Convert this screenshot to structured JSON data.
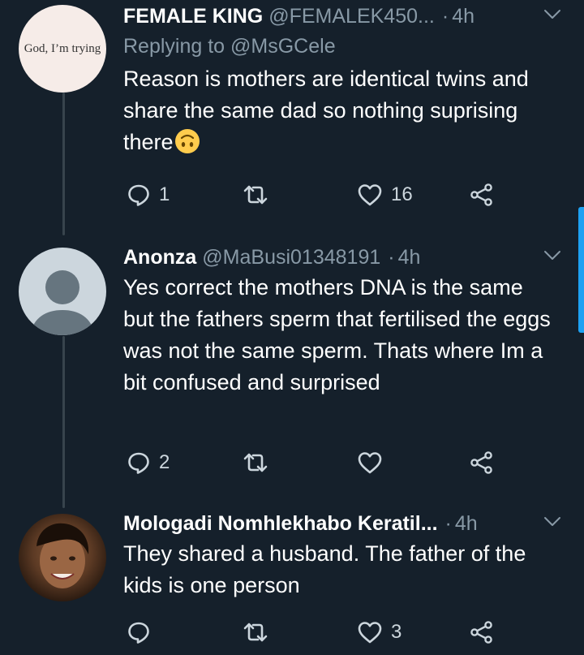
{
  "tweets": [
    {
      "avatar_text": "God, I’m trying",
      "name": "FEMALE KING",
      "handle": "@FEMALEK450...",
      "dot": "·",
      "time": "4h",
      "reply_prefix": "Replying to",
      "reply_handle": "@MsGCele",
      "text": "Reason is mothers are identical twins and share the same dad so nothing suprising there",
      "emoji": "upside-down-face",
      "replies": "1",
      "retweets": "",
      "likes": "16"
    },
    {
      "name": "Anonza",
      "handle": "@MaBusi01348191",
      "dot": "·",
      "time": "4h",
      "text": "Yes correct the mothers DNA is the same but the fathers sperm that fertilised the eggs was not the same sperm. Thats where Im a bit confused and surprised",
      "replies": "2",
      "retweets": "",
      "likes": ""
    },
    {
      "name": "Mologadi Nomhlekhabo Keratil...",
      "dot": "·",
      "time": "4h",
      "text": "They shared a husband. The father of the kids is one person",
      "replies": "",
      "retweets": "",
      "likes": "3"
    }
  ],
  "colors": {
    "background": "#15202b",
    "secondary_text": "#8899a6",
    "thread_line": "#38444d",
    "scrollbar": "#1da1f2"
  }
}
